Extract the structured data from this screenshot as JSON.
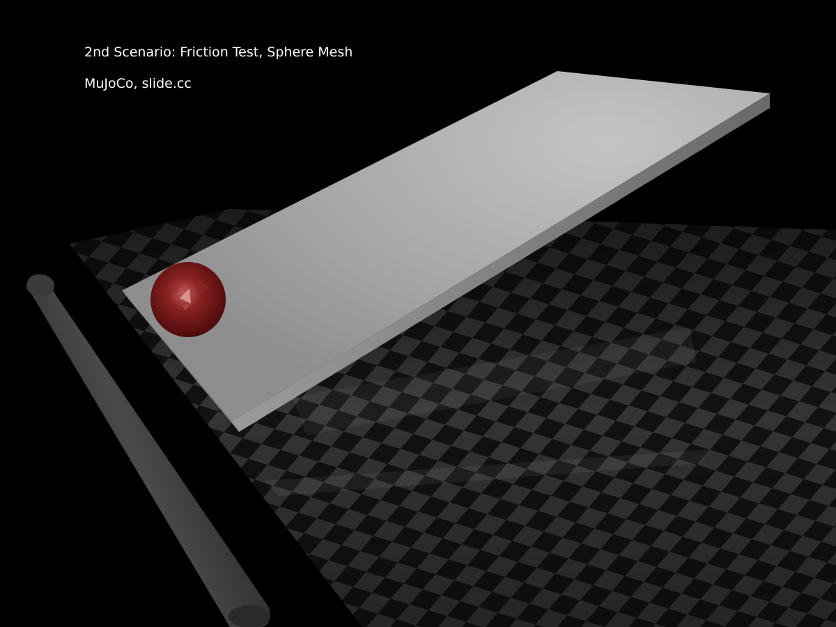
{
  "overlay": {
    "title": "2nd Scenario: Friction Test, Sphere Mesh",
    "subtitle": "MuJoCo, slide.cc"
  },
  "scene": {
    "objects": [
      "checkered-floor",
      "inclined-slide-plate",
      "red-sphere-mesh",
      "gray-cylinder-rod"
    ],
    "colors": {
      "background": "#000000",
      "floor_dark": "#141414",
      "floor_light": "#3a3a3a",
      "plate_top": "#b3b3b3",
      "plate_side": "#6e6e6e",
      "sphere": "#7a1a1a",
      "rod": "#3c3c3c"
    }
  }
}
